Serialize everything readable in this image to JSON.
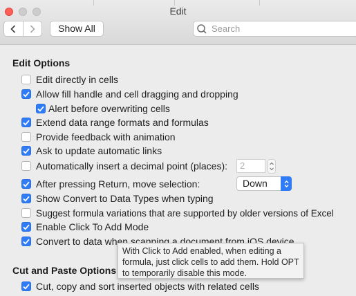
{
  "window": {
    "title": "Edit"
  },
  "toolbar": {
    "show_all_label": "Show All",
    "search_placeholder": "Search"
  },
  "edit_options": {
    "title": "Edit Options",
    "items": [
      {
        "label": "Edit directly in cells",
        "checked": false
      },
      {
        "label": "Allow fill handle and cell dragging and dropping",
        "checked": true
      },
      {
        "label": "Alert before overwriting cells",
        "checked": true
      },
      {
        "label": "Extend data range formats and formulas",
        "checked": true
      },
      {
        "label": "Provide feedback with animation",
        "checked": false
      },
      {
        "label": "Ask to update automatic links",
        "checked": true
      },
      {
        "label": "Automatically insert a decimal point (places):",
        "checked": false
      },
      {
        "label": "After pressing Return, move selection:",
        "checked": true
      },
      {
        "label": "Show Convert to Data Types when typing",
        "checked": true
      },
      {
        "label": "Suggest formula variations that are supported by older versions of Excel",
        "checked": false
      },
      {
        "label": "Enable Click To Add Mode",
        "checked": true
      },
      {
        "label": "Convert to data when scanning a document from iOS device",
        "checked": true
      }
    ],
    "decimal_places_value": "2",
    "move_selection_value": "Down"
  },
  "cut_paste": {
    "title": "Cut and Paste Options",
    "items": [
      {
        "label": "Cut, copy and sort inserted objects with related cells",
        "checked": true
      }
    ]
  },
  "tooltip": {
    "text": "With Click to Add enabled, when editing a formula, just click cells to add them. Hold OPT to temporarily disable this mode."
  },
  "colors": {
    "accent": "#2f7cf6",
    "close_button": "#fe5f57"
  }
}
